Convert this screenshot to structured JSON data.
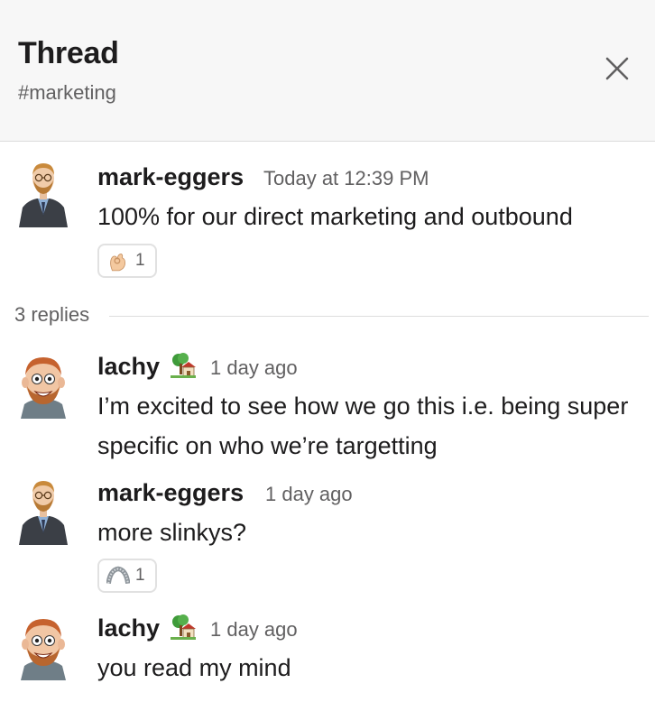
{
  "header": {
    "title": "Thread",
    "channel": "#marketing",
    "close_icon": "close-icon"
  },
  "parent_message": {
    "author": "mark-eggers",
    "time": "Today at 12:39 PM",
    "text": "100% for our direct marketing and outbound",
    "reaction": {
      "emoji": "ok-hand-emoji",
      "count": "1"
    }
  },
  "replies_label": "3 replies",
  "replies": [
    {
      "author": "lachy",
      "status_emoji": "house-with-garden-emoji",
      "time": "1 day ago",
      "text": "I’m excited to see how we go this i.e. being super specific on who we’re targetting"
    },
    {
      "author": "mark-eggers",
      "time": "1 day ago",
      "text": "more slinkys?",
      "reaction": {
        "emoji": "slinky-emoji",
        "count": "1"
      }
    },
    {
      "author": "lachy",
      "status_emoji": "house-with-garden-emoji",
      "time": "1 day ago",
      "text": "you read my mind"
    }
  ],
  "colors": {
    "header_bg": "#f7f7f7",
    "text": "#1d1c1d",
    "muted": "#616061",
    "divider": "#dddddd"
  }
}
